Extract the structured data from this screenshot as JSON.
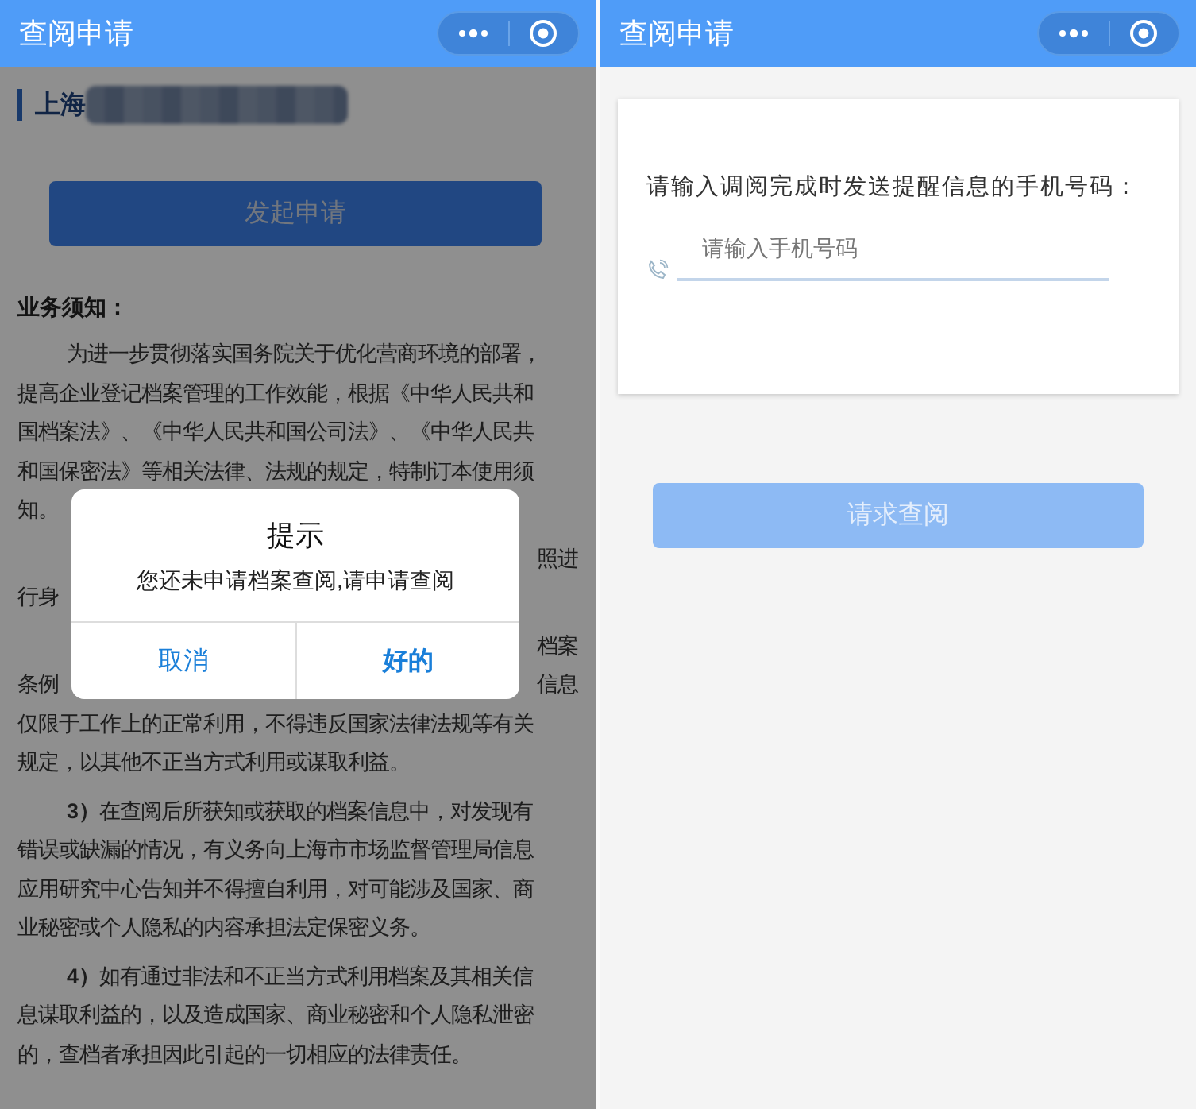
{
  "screens": [
    {
      "kind": "notice",
      "title": "查阅申请",
      "company_prefix": "上海",
      "apply_button": {
        "label": "发起申请",
        "disabled": true
      },
      "notice_heading": "业务须知：",
      "paragraphs": [
        {
          "lines": [
            {
              "left": "为进一步贯彻落实国务院关于优化营商环境的部署，"
            },
            {
              "left": "提高企业登记档案管理的工作效能，根据《中华人民共和"
            },
            {
              "left": "国档案法》、《中华人民共和国公司法》、《中华人民共"
            },
            {
              "left": "和国保密法》等相关法律、法规的规定，特制订本使用须"
            },
            {
              "left": "知。"
            }
          ]
        },
        {
          "lines": [
            {
              "right": "照进"
            },
            {
              "left": "行身"
            }
          ]
        },
        {
          "lines": [
            {
              "right": "档案"
            },
            {
              "left": "条例",
              "right": "信息"
            },
            {
              "left": "仅限于工作上的正常利用，不得违反国家法律法规等有关"
            },
            {
              "left": "规定，以其他不正当方式利用或谋取利益。"
            }
          ]
        },
        {
          "lines": [
            {
              "left": "**3）**在查阅后所获知或获取的档案信息中，对发现有"
            },
            {
              "left": "错误或缺漏的情况，有义务向上海市市场监督管理局信息"
            },
            {
              "left": "应用研究中心告知并不得擅自利用，对可能涉及国家、商"
            },
            {
              "left": "业秘密或个人隐私的内容承担法定保密义务。"
            }
          ]
        },
        {
          "lines": [
            {
              "left": "**4）**如有通过非法和不正当方式利用档案及其相关信"
            },
            {
              "left": "息谋取利益的，以及造成国家、商业秘密和个人隐私泄密"
            },
            {
              "left": "的，查档者承担因此引起的一切相应的法律责任。"
            }
          ]
        }
      ],
      "dialog": {
        "title": "提示",
        "message": "您还未申请档案查阅,请申请查阅",
        "buttons": [
          {
            "label": "取消",
            "kind": "cancel"
          },
          {
            "label": "好的",
            "kind": "confirm"
          }
        ]
      }
    },
    {
      "kind": "form",
      "title": "查阅申请",
      "prompt": "请输入调阅完成时发送提醒信息的手机号码：",
      "phone_field": {
        "placeholder": "请输入手机号码"
      },
      "submit_button": {
        "label": "请求查阅",
        "disabled": true
      }
    }
  ]
}
